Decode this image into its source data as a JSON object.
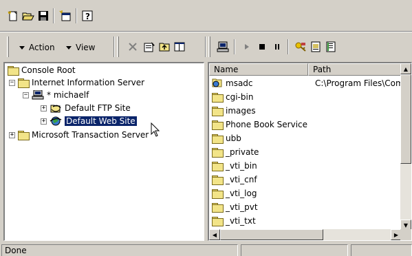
{
  "toolbar_top": {
    "buttons": [
      "new-console-icon",
      "open-icon",
      "save-icon",
      "new-window-icon",
      "help-icon"
    ]
  },
  "toolbar_main": {
    "action_label": "Action",
    "view_label": "View"
  },
  "tree": {
    "items": [
      {
        "label": "Console Root"
      },
      {
        "label": "Internet Information Server"
      },
      {
        "label": "* michaelf"
      },
      {
        "label": "Default FTP Site"
      },
      {
        "label": "Default Web Site"
      },
      {
        "label": "Microsoft Transaction Server"
      }
    ]
  },
  "list": {
    "columns": [
      "Name",
      "Path"
    ],
    "rows": [
      {
        "name": "msadc",
        "path": "C:\\Program Files\\Comm"
      },
      {
        "name": "cgi-bin",
        "path": ""
      },
      {
        "name": "images",
        "path": ""
      },
      {
        "name": "Phone Book Service",
        "path": ""
      },
      {
        "name": "ubb",
        "path": ""
      },
      {
        "name": "_private",
        "path": ""
      },
      {
        "name": "_vti_bin",
        "path": ""
      },
      {
        "name": "_vti_cnf",
        "path": ""
      },
      {
        "name": "_vti_log",
        "path": ""
      },
      {
        "name": "_vti_pvt",
        "path": ""
      },
      {
        "name": "_vti_txt",
        "path": ""
      }
    ]
  },
  "status": {
    "text": "Done"
  },
  "colors": {
    "selection": "#0a246a",
    "face": "#d4d0c8"
  }
}
